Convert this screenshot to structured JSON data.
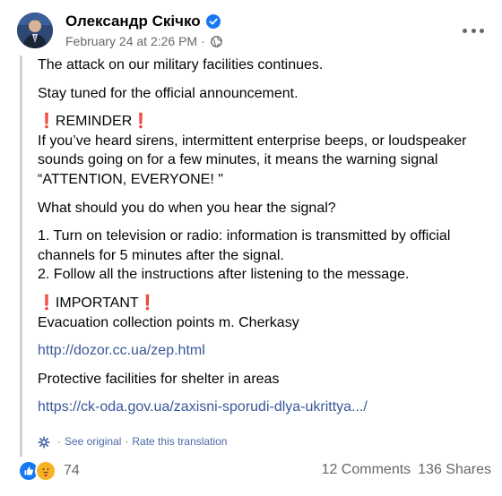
{
  "header": {
    "author": "Олександр Скічко",
    "date": "February 24 at 2:26 PM",
    "separator": "·"
  },
  "body": {
    "p1": "The attack on our military facilities continues.",
    "p2": "Stay tuned for the official announcement.",
    "reminder_title": "REMINDER",
    "reminder_text": "If you’ve heard sirens, intermittent enterprise beeps, or loudspeaker sounds going on for a few minutes, it means the warning signal “ATTENTION, EVERYONE! \"",
    "question": "What should you do when you hear the signal?",
    "step1": "1. Turn on television or radio: information is transmitted by official channels for 5 minutes after the signal.",
    "step2": "2. Follow all the instructions after listening to the message.",
    "important_title": "IMPORTANT",
    "evacuation": "Evacuation collection points m. Cherkasy",
    "link1": "http://dozor.cc.ua/zep.html",
    "shelter": "Protective facilities for shelter in areas",
    "link2": "https://ck-oda.gov.ua/zaxisni-sporudi-dlya-ukrittya.../",
    "exclamation": "❗"
  },
  "translation": {
    "see_original": "See original",
    "rate": "Rate this translation",
    "separator": "·"
  },
  "footer": {
    "reaction_count": "74",
    "comments": "12 Comments",
    "shares": "136 Shares"
  },
  "colors": {
    "link": "#385898",
    "verified": "#1877f2",
    "exclamation": "#e02a2a"
  }
}
